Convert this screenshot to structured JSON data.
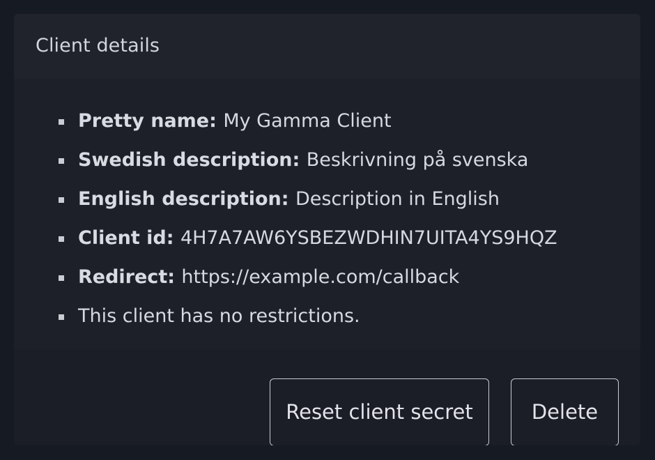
{
  "card": {
    "title": "Client details"
  },
  "details": {
    "pretty_name": {
      "label": "Pretty name:",
      "value": "My Gamma Client"
    },
    "swedish_description": {
      "label": "Swedish description:",
      "value": "Beskrivning på svenska"
    },
    "english_description": {
      "label": "English description:",
      "value": "Description in English"
    },
    "client_id": {
      "label": "Client id:",
      "value": "4H7A7AW6YSBEZWDHIN7UITA4YS9HQZ"
    },
    "redirect": {
      "label": "Redirect:",
      "value": "https://example.com/callback"
    },
    "restrictions_text": "This client has no restrictions."
  },
  "actions": {
    "reset_label": "Reset client secret",
    "delete_label": "Delete"
  },
  "colors": {
    "page_background": "#161a23",
    "card_background": "#1e2029",
    "text": "#d4d7dd",
    "button_border": "#c9ccd3"
  }
}
